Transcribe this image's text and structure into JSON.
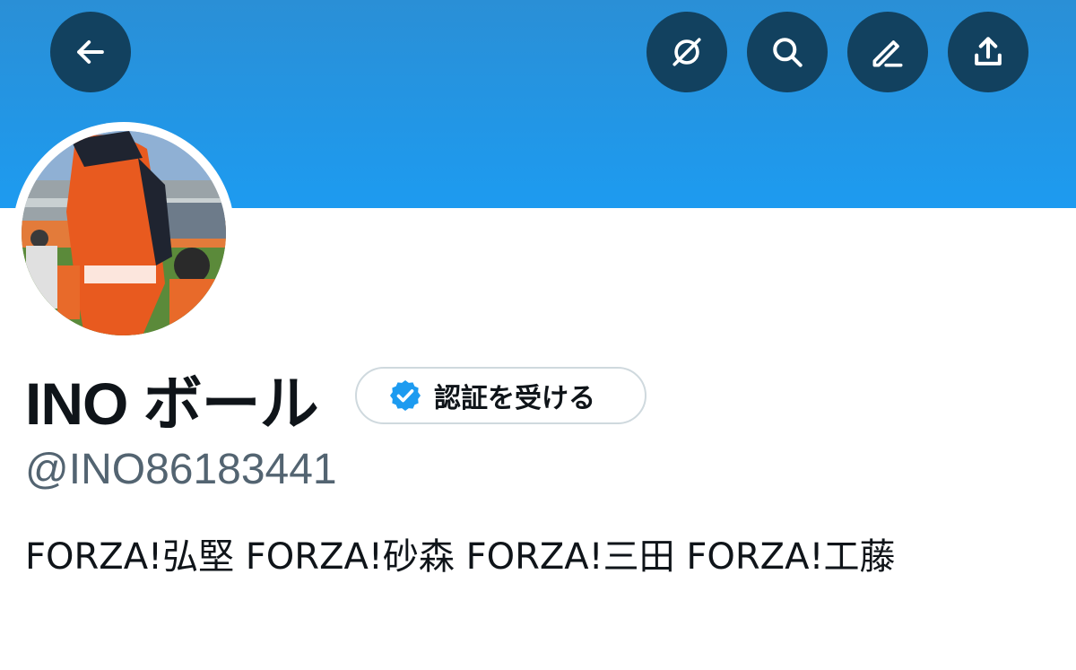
{
  "header": {
    "back_icon": "arrow-left-icon",
    "actions": [
      {
        "icon": "no-notifications-icon"
      },
      {
        "icon": "search-icon"
      },
      {
        "icon": "edit-icon"
      },
      {
        "icon": "share-icon"
      }
    ]
  },
  "profile": {
    "display_name": "INO ボール",
    "verify_button_label": "認証を受ける",
    "handle": "@INO86183441",
    "bio": "FORZA!弘堅 FORZA!砂森 FORZA!三田 FORZA!工藤"
  },
  "colors": {
    "banner": "#1d9bf0",
    "icon_button_bg": "#12415f",
    "verified_badge": "#1d9bf0",
    "handle_text": "#536471"
  }
}
